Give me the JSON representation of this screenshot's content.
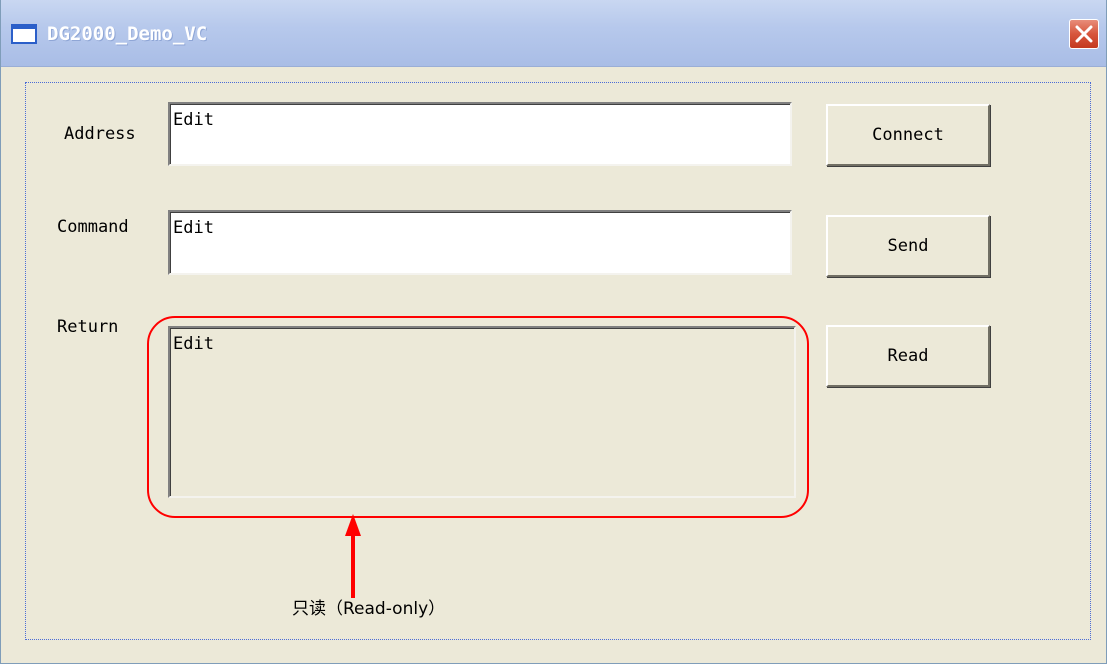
{
  "window": {
    "title": "DG2000_Demo_VC"
  },
  "fields": {
    "address_label": "Address",
    "address_value": "Edit",
    "command_label": "Command",
    "command_value": "Edit",
    "return_label": "Return",
    "return_value": "Edit"
  },
  "buttons": {
    "connect_label": "Connect",
    "send_label": "Send",
    "read_label": "Read"
  },
  "annotation": {
    "text": "只读（Read-only）",
    "color": "#ff0000"
  },
  "icons": {
    "app": "window-icon",
    "close": "close-icon"
  }
}
